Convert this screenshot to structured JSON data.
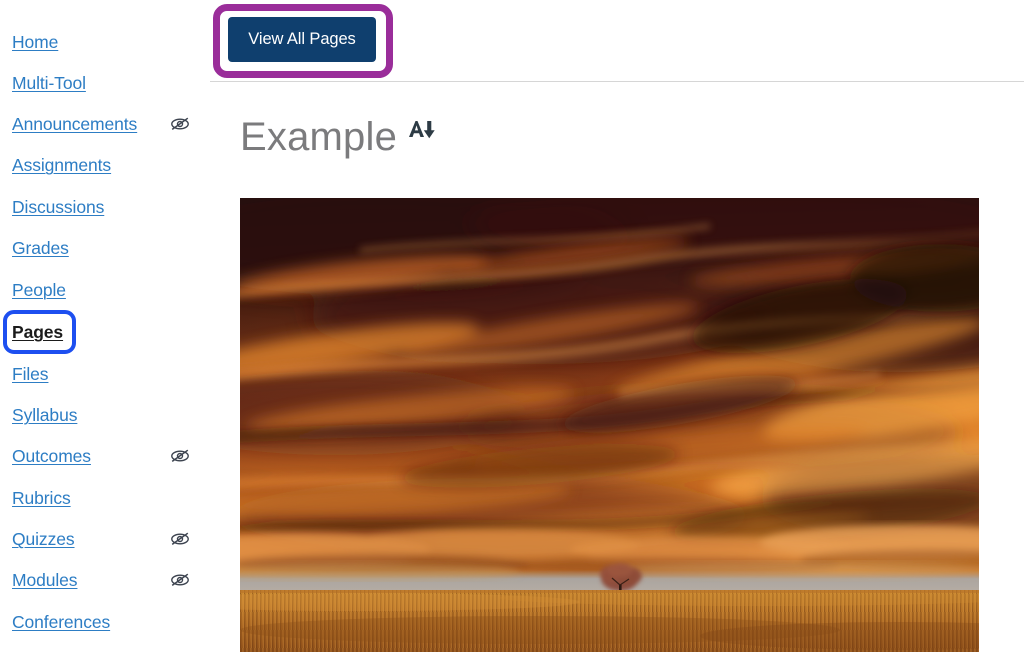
{
  "sidebar": {
    "name": "course-navigation",
    "items": [
      {
        "label": "Home",
        "hidden_icon": false,
        "active": false
      },
      {
        "label": "Multi-Tool",
        "hidden_icon": false,
        "active": false
      },
      {
        "label": "Announcements",
        "hidden_icon": true,
        "active": false
      },
      {
        "label": "Assignments",
        "hidden_icon": false,
        "active": false
      },
      {
        "label": "Discussions",
        "hidden_icon": false,
        "active": false
      },
      {
        "label": "Grades",
        "hidden_icon": false,
        "active": false
      },
      {
        "label": "People",
        "hidden_icon": false,
        "active": false
      },
      {
        "label": "Pages",
        "hidden_icon": false,
        "active": true
      },
      {
        "label": "Files",
        "hidden_icon": false,
        "active": false
      },
      {
        "label": "Syllabus",
        "hidden_icon": false,
        "active": false
      },
      {
        "label": "Outcomes",
        "hidden_icon": true,
        "active": false
      },
      {
        "label": "Rubrics",
        "hidden_icon": false,
        "active": false
      },
      {
        "label": "Quizzes",
        "hidden_icon": true,
        "active": false
      },
      {
        "label": "Modules",
        "hidden_icon": true,
        "active": false
      },
      {
        "label": "Conferences",
        "hidden_icon": false,
        "active": false
      }
    ],
    "hidden_icon_name": "eye-slash-icon",
    "link_color": "#2d7dc4",
    "active_color": "#1b1b1b"
  },
  "toolbar": {
    "view_all_pages_label": "View All Pages",
    "button_color": "#0f3f6e",
    "button_text_color": "#ffffff"
  },
  "annotations": {
    "view_all_pages_highlight_color": "#9a2d9a",
    "pages_highlight_color": "#1d4ff0"
  },
  "main": {
    "page_title": "Example",
    "title_color": "#7b7b7d",
    "immersive_reader_icon": "text-download-icon",
    "body_image": {
      "name": "sunset-field-tree-photo",
      "alt": "Lone tree in a golden wheat field under a dramatic orange sunset sky"
    }
  }
}
